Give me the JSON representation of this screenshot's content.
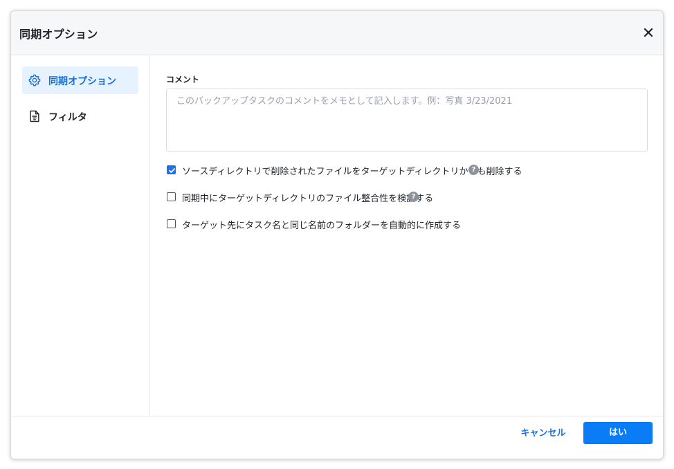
{
  "dialog": {
    "title": "同期オプション"
  },
  "sidebar": {
    "items": [
      {
        "label": "同期オプション",
        "icon": "gear-icon",
        "active": true
      },
      {
        "label": "フィルタ",
        "icon": "document-filter-icon",
        "active": false
      }
    ]
  },
  "comment": {
    "label": "コメント",
    "value": "",
    "placeholder": "このバックアップタスクのコメントをメモとして記入します。例：写真 3/23/2021"
  },
  "options": [
    {
      "label": "ソースディレクトリで削除されたファイルをターゲットディレクトリからも削除する",
      "checked": true,
      "help": true
    },
    {
      "label": "同期中にターゲットディレクトリのファイル整合性を検証する",
      "checked": false,
      "help": true
    },
    {
      "label": "ターゲット先にタスク名と同じ名前のフォルダーを自動的に作成する",
      "checked": false,
      "help": false
    }
  ],
  "help_symbol": "?",
  "footer": {
    "cancel_label": "キャンセル",
    "ok_label": "はい"
  },
  "colors": {
    "accent": "#1a73e8",
    "primary_button": "#0a7cf5",
    "active_nav_bg": "#e6f2fd",
    "header_bg": "#f6f7f8"
  }
}
